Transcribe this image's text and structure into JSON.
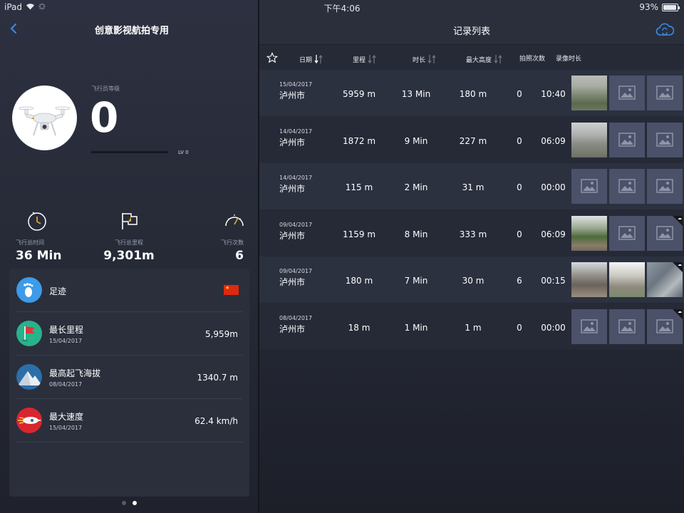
{
  "status_bar": {
    "device": "iPad",
    "time": "下午4:06",
    "battery": "93%",
    "battery_level": 0.93
  },
  "left_panel": {
    "title": "创意影视航拍专用",
    "pilot_level_label": "飞行员等级",
    "pilot_level": "0",
    "level_tag": "LV 0",
    "level_progress": 0,
    "stats": [
      {
        "icon": "clock-icon",
        "label": "飞行总时间",
        "value": "36 Min"
      },
      {
        "icon": "flag-outline-icon",
        "label": "飞行总里程",
        "value": "9,301m"
      },
      {
        "icon": "speedometer-icon",
        "label": "飞行次数",
        "value": "6"
      }
    ],
    "records": [
      {
        "icon": "footprint-icon",
        "title": "足迹",
        "date": "",
        "value": "",
        "icon_color": "#3d9be9"
      },
      {
        "icon": "red-flag-icon",
        "title": "最长里程",
        "date": "15/04/2017",
        "value": "5,959m",
        "icon_color": "#27b38c"
      },
      {
        "icon": "mountain-icon",
        "title": "最高起飞海拔",
        "date": "08/04/2017",
        "value": "1340.7 m",
        "icon_color": "#2c6fa8"
      },
      {
        "icon": "rocket-icon",
        "title": "最大速度",
        "date": "15/04/2017",
        "value": "62.4 km/h",
        "icon_color": "#d9262e"
      }
    ],
    "pager": {
      "pages": 2,
      "active": 2
    }
  },
  "right_panel": {
    "title": "记录列表",
    "columns": {
      "date": "日期",
      "distance": "里程",
      "duration": "时长",
      "max_altitude": "最大高度",
      "photos": "拍照次数",
      "video_duration": "录像时长"
    },
    "rows": [
      {
        "date": "15/04/2017",
        "city": "泸州市",
        "distance": "5959 m",
        "duration": "13 Min",
        "max_altitude": "180 m",
        "photos": "0",
        "video": "10:40",
        "thumbs": [
          "photo-a",
          "placeholder",
          "placeholder"
        ],
        "cloud": false
      },
      {
        "date": "14/04/2017",
        "city": "泸州市",
        "distance": "1872 m",
        "duration": "9 Min",
        "max_altitude": "227 m",
        "photos": "0",
        "video": "06:09",
        "thumbs": [
          "photo-b",
          "placeholder",
          "placeholder"
        ],
        "cloud": false
      },
      {
        "date": "14/04/2017",
        "city": "泸州市",
        "distance": "115 m",
        "duration": "2 Min",
        "max_altitude": "31 m",
        "photos": "0",
        "video": "00:00",
        "thumbs": [
          "placeholder",
          "placeholder",
          "placeholder"
        ],
        "cloud": false
      },
      {
        "date": "09/04/2017",
        "city": "泸州市",
        "distance": "1159 m",
        "duration": "8 Min",
        "max_altitude": "333 m",
        "photos": "0",
        "video": "06:09",
        "thumbs": [
          "photo-c",
          "placeholder",
          "placeholder"
        ],
        "cloud": true
      },
      {
        "date": "09/04/2017",
        "city": "泸州市",
        "distance": "180 m",
        "duration": "7 Min",
        "max_altitude": "30 m",
        "photos": "6",
        "video": "00:15",
        "thumbs": [
          "photo-d",
          "photo-e",
          "photo-f"
        ],
        "cloud": true
      },
      {
        "date": "08/04/2017",
        "city": "泸州市",
        "distance": "18 m",
        "duration": "1 Min",
        "max_altitude": "1 m",
        "photos": "0",
        "video": "00:00",
        "thumbs": [
          "placeholder",
          "placeholder",
          "placeholder"
        ],
        "cloud": true
      }
    ]
  }
}
